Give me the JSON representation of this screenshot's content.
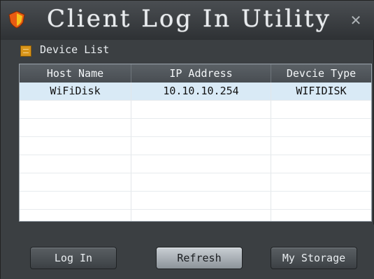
{
  "window": {
    "title": "Client Log In Utility"
  },
  "device_list": {
    "label": "Device List"
  },
  "table": {
    "columns": [
      "Host Name",
      "IP Address",
      "Devcie Type"
    ],
    "rows": [
      {
        "host_name": "WiFiDisk",
        "ip_address": "10.10.10.254",
        "device_type": "WIFIDISK",
        "selected": true
      }
    ],
    "empty_rows": 7
  },
  "buttons": {
    "login": "Log In",
    "refresh": "Refresh",
    "my_storage": "My Storage"
  },
  "colors": {
    "selected_row": "#d9eaf6",
    "accent_icon": "#d8951a"
  }
}
